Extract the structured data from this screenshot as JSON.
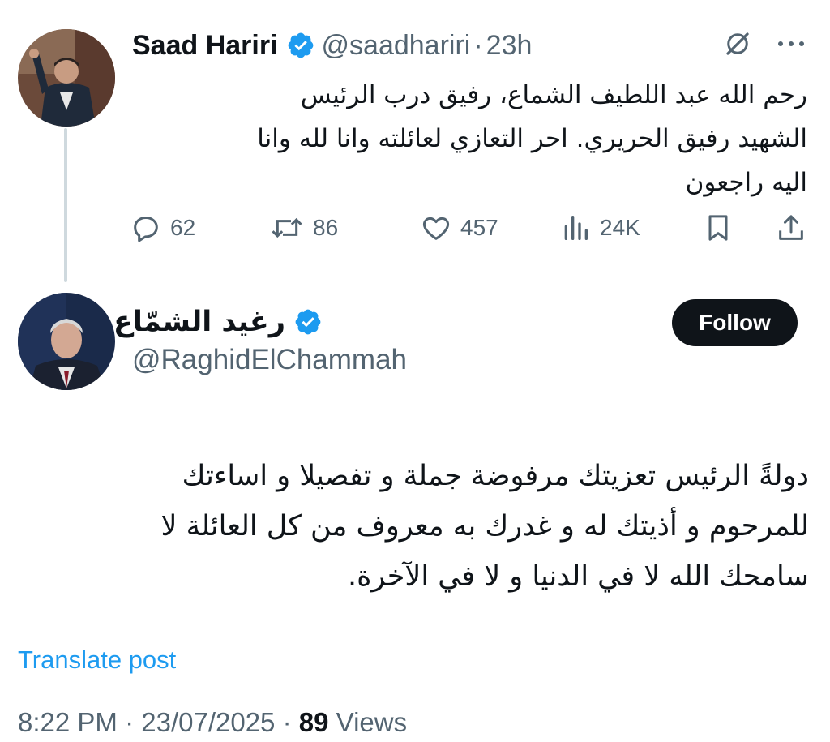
{
  "original_post": {
    "author_name": "Saad Hariri",
    "handle": "@saadhariri",
    "separator": "·",
    "age": "23h",
    "text_lines": [
      "رحم الله عبد اللطيف الشماع، رفيق درب الرئيس",
      "الشهيد رفيق الحريري. احر التعازي لعائلته وانا لله وانا",
      "اليه راجعون"
    ],
    "stats": {
      "replies": "62",
      "reposts": "86",
      "likes": "457",
      "views": "24K"
    },
    "icons": [
      "verified-badge-icon",
      "grok-icon",
      "more-icon",
      "reply-icon",
      "repost-icon",
      "like-icon",
      "views-icon",
      "bookmark-icon",
      "share-icon"
    ]
  },
  "reply_post": {
    "author_name": "رغيد الشمّاع",
    "handle": "@RaghidElChammah",
    "follow_label": "Follow",
    "text_lines": [
      "دولةً الرئيس تعزيتك مرفوضة  جملة و تفصيلا و اساءتك",
      "للمرحوم و أذيتك له و غدرك به معروف من كل العائلة لا",
      "سامحك الله لا في الدنيا و لا في الآخرة."
    ],
    "translate_label": "Translate post",
    "time": "8:22 PM",
    "separator": "·",
    "date": "23/07/2025",
    "views_count": "89",
    "views_label": "Views"
  },
  "colors": {
    "text": "#0f1419",
    "muted": "#536471",
    "accent": "#1d9bf0",
    "follow_bg": "#0f1419"
  }
}
